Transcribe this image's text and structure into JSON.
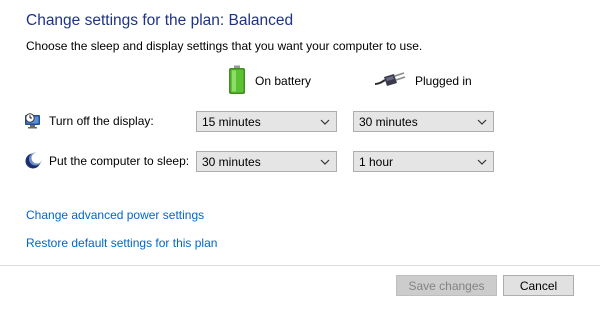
{
  "header": {
    "title": "Change settings for the plan: Balanced",
    "subtitle": "Choose the sleep and display settings that you want your computer to use."
  },
  "columns": {
    "on_battery": "On battery",
    "plugged_in": "Plugged in"
  },
  "settings": {
    "display": {
      "label": "Turn off the display:",
      "icon": "monitor-clock-icon",
      "on_battery": "15 minutes",
      "plugged_in": "30 minutes"
    },
    "sleep": {
      "label": "Put the computer to sleep:",
      "icon": "moon-icon",
      "on_battery": "30 minutes",
      "plugged_in": "1 hour"
    }
  },
  "links": {
    "advanced": "Change advanced power settings",
    "restore": "Restore default settings for this plan"
  },
  "buttons": {
    "save": "Save changes",
    "cancel": "Cancel"
  },
  "colors": {
    "title": "#1e3287",
    "link": "#0066cc",
    "battery_green": "#5cc233"
  }
}
